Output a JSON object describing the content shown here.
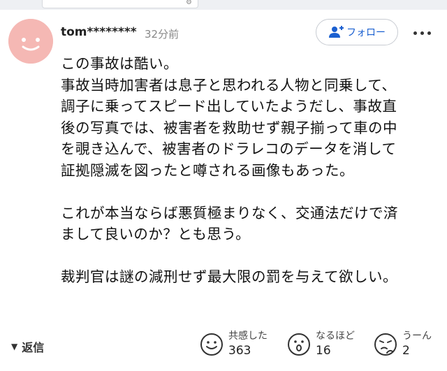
{
  "comment": {
    "username": "tom********",
    "time": "32分前",
    "follow_label": "フォロー",
    "lines": [
      "この事故は酷い。",
      "事故当時加害者は息子と思われる人物と同乗して、",
      "調子に乗ってスピード出していたようだし、事故直",
      "後の写真では、被害者を救助せず親子揃って車の中",
      "を覗き込んで、被害者のドラレコのデータを消して",
      "証拠隠滅を図ったと噂される画像もあった。",
      "",
      "これが本当ならば悪質極まりなく、交通法だけで済",
      "まして良いのか？とも思う。",
      "",
      "裁判官は謎の減刑せず最大限の罰を与えて欲しい。"
    ]
  },
  "footer": {
    "reply_label": "返信",
    "reactions": [
      {
        "label": "共感した",
        "count": "363",
        "icon": "smile-face-icon"
      },
      {
        "label": "なるほど",
        "count": "16",
        "icon": "surprised-face-icon"
      },
      {
        "label": "うーん",
        "count": "2",
        "icon": "thinking-face-icon"
      }
    ]
  },
  "colors": {
    "avatar_bg": "#f5b8b4",
    "follow_accent": "#1a5fd0",
    "muted_text": "#888888"
  }
}
